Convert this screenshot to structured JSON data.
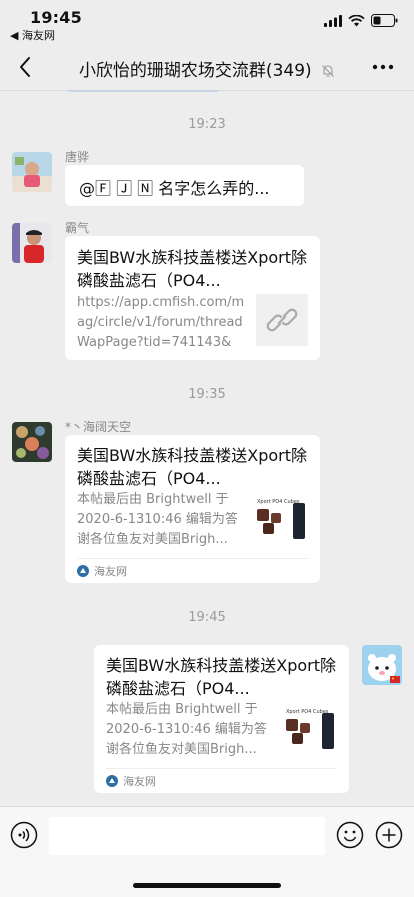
{
  "status_bar": {
    "time": "19:45",
    "back_app": "◀ 海友网"
  },
  "nav": {
    "title": "小欣怡的珊瑚农场交流群(349)"
  },
  "timestamps": [
    "19:23",
    "19:35",
    "19:45"
  ],
  "messages": [
    {
      "sender": "唐骅",
      "text": "@🄵 🄹 🄽 名字怎么弄的..."
    },
    {
      "sender": "霸气",
      "title": "美国BW水族科技盖楼送Xport除磷酸盐滤石（PO4...",
      "desc": "https://app.cmfish.com/mag/circle/v1/forum/threadWapPage?tid=741143&t..."
    },
    {
      "sender": "*丶海阔天空",
      "title": "美国BW水族科技盖楼送Xport除磷酸盐滤石（PO4...",
      "desc": "本帖最后由 Brightwell 于 2020-6-1310:46 编辑为答谢各位鱼友对美国Brigh...",
      "source": "海友网",
      "thumb_text": "Xport PO4 Cubes"
    },
    {
      "sender": "me",
      "title": "美国BW水族科技盖楼送Xport除磷酸盐滤石（PO4...",
      "desc": "本帖最后由 Brightwell 于 2020-6-1310:46 编辑为答谢各位鱼友对美国Brigh...",
      "source": "海友网",
      "thumb_text": "Xport PO4 Cubes"
    }
  ],
  "colors": {
    "background": "#EDEDED",
    "bubble": "#FFFFFF",
    "muted": "#888888"
  }
}
